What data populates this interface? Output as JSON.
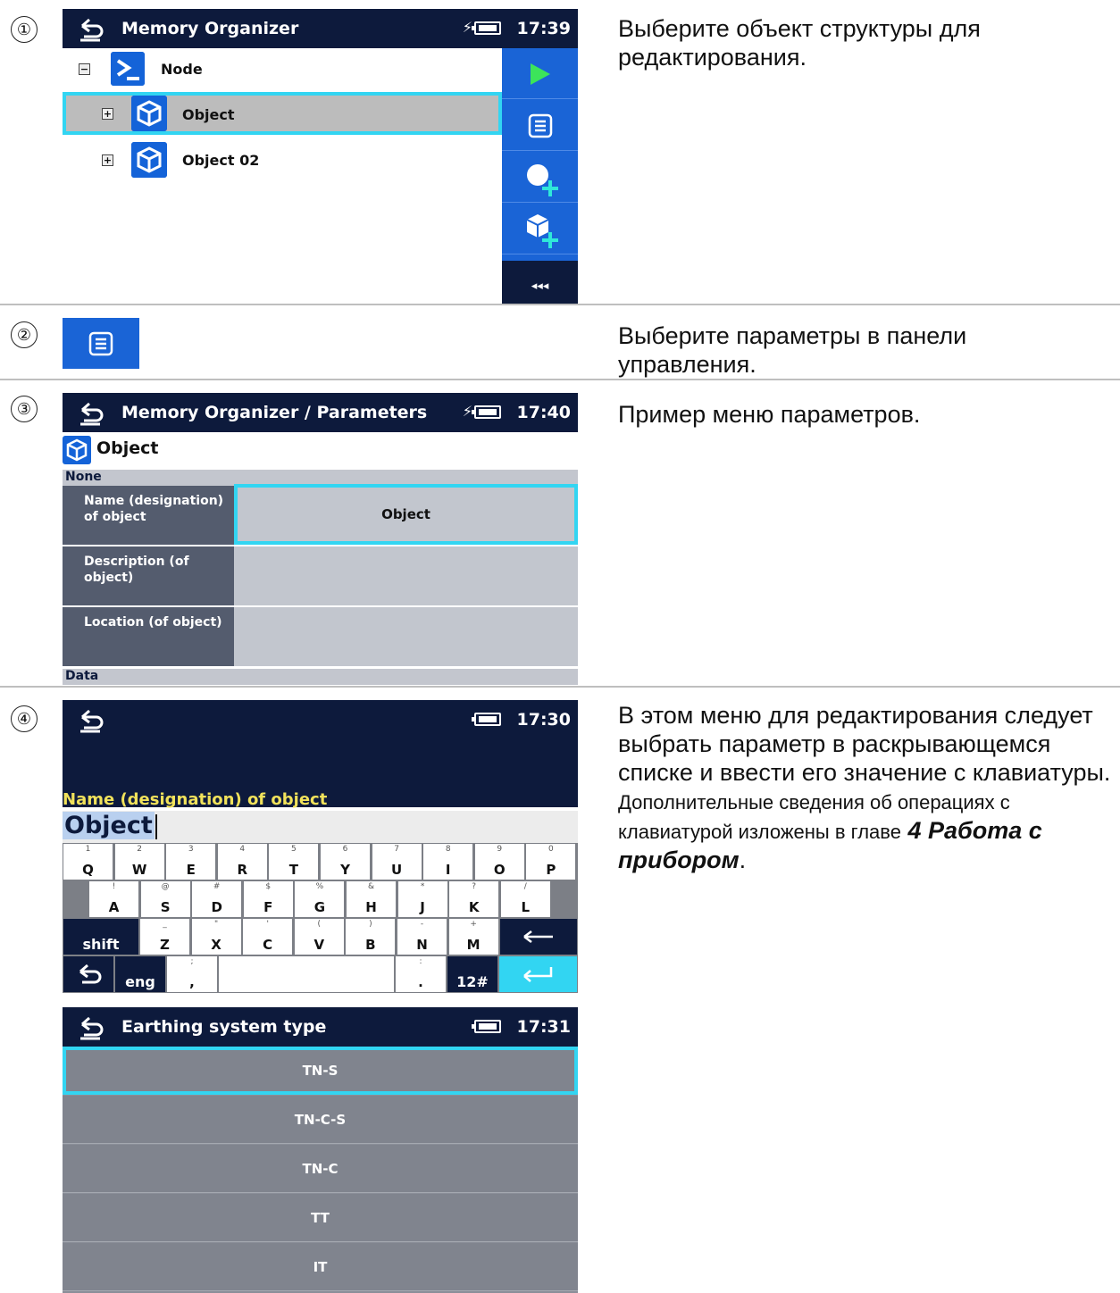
{
  "steps": [
    {
      "number": "①",
      "text": "Выберите объект структуры для редактирования."
    },
    {
      "number": "②",
      "text": "Выберите параметры в панели управления."
    },
    {
      "number": "③",
      "text": "Пример меню параметров."
    },
    {
      "number": "④",
      "text_large": "В этом меню для редактирования следует выбрать параметр в раскрывающемся списке и ввести его значение с клавиатуры.",
      "text_small_1": "Дополнительные сведения об операциях с клавиатурой изложены в главе",
      "text_ref": "4 Работа с прибором",
      "text_end": "."
    }
  ],
  "screen1": {
    "title": "Memory Organizer",
    "time": "17:39",
    "tree": [
      {
        "label": "Node",
        "expander": "−"
      },
      {
        "label": "Object",
        "expander": "+"
      },
      {
        "label": "Object 02",
        "expander": "+"
      }
    ],
    "sidebar": {
      "collapse_label": "◂◂◂"
    }
  },
  "screen3": {
    "title": "Memory Organizer / Parameters",
    "time": "17:40",
    "object_title": "Object",
    "section_none": "None",
    "section_data": "Data",
    "params": [
      {
        "label": "Name (designation) of object",
        "value": "Object"
      },
      {
        "label": "Description (of object)",
        "value": ""
      },
      {
        "label": "Location (of object)",
        "value": ""
      }
    ]
  },
  "screen4": {
    "time": "17:30",
    "field_label": "Name (designation) of object",
    "input_value": "Object",
    "row1": [
      [
        "1",
        "Q"
      ],
      [
        "2",
        "W"
      ],
      [
        "3",
        "E"
      ],
      [
        "4",
        "R"
      ],
      [
        "5",
        "T"
      ],
      [
        "6",
        "Y"
      ],
      [
        "7",
        "U"
      ],
      [
        "8",
        "I"
      ],
      [
        "9",
        "O"
      ],
      [
        "0",
        "P"
      ]
    ],
    "row2": [
      [
        "!",
        "A"
      ],
      [
        "@",
        "S"
      ],
      [
        "#",
        "D"
      ],
      [
        "$",
        "F"
      ],
      [
        "%",
        "G"
      ],
      [
        "&",
        "H"
      ],
      [
        "*",
        "J"
      ],
      [
        "?",
        "K"
      ],
      [
        "/",
        "L"
      ]
    ],
    "row3": [
      [
        "_",
        "Z"
      ],
      [
        "\"",
        "X"
      ],
      [
        "'",
        "C"
      ],
      [
        "(",
        "V"
      ],
      [
        ")",
        "B"
      ],
      [
        "-",
        "N"
      ],
      [
        "+",
        "M"
      ]
    ],
    "shift": "shift",
    "eng": "eng",
    "num_toggle": "12#",
    "comma": ",",
    "semicolon": ";",
    "period": ".",
    "colon": ":"
  },
  "screen5": {
    "title": "Earthing system type",
    "time": "17:31",
    "options": [
      "TN-S",
      "TN-C-S",
      "TN-C",
      "TT",
      "IT"
    ]
  }
}
